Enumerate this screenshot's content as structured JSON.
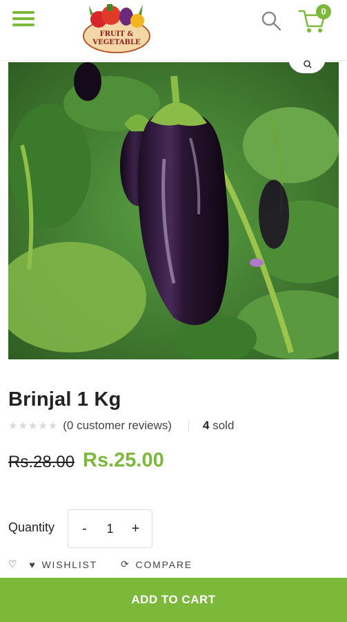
{
  "header": {
    "menu_icon": "hamburger-menu-icon",
    "logo_text_line1": "FRUIT &",
    "logo_text_line2": "VEGETABLE",
    "search_icon": "search-icon",
    "cart_icon": "cart-icon",
    "cart_count": "0",
    "brand_color": "#7cb83a"
  },
  "product": {
    "image_description_icon": "eggplant-photo",
    "zoom_icon": "zoom-icon",
    "title": "Brinjal 1 Kg",
    "rating_stars": 0,
    "reviews_text": "(0 customer reviews)",
    "sold_count": "4",
    "sold_label": " sold",
    "old_price": "Rs.28.00",
    "new_price": "Rs.25.00"
  },
  "quantity": {
    "label": "Quantity",
    "minus": "-",
    "value": "1",
    "plus": "+"
  },
  "actions": {
    "wishlist_label": "WISHLIST",
    "compare_label": "COMPARE"
  },
  "cta": {
    "add_to_cart": "ADD TO CART"
  }
}
